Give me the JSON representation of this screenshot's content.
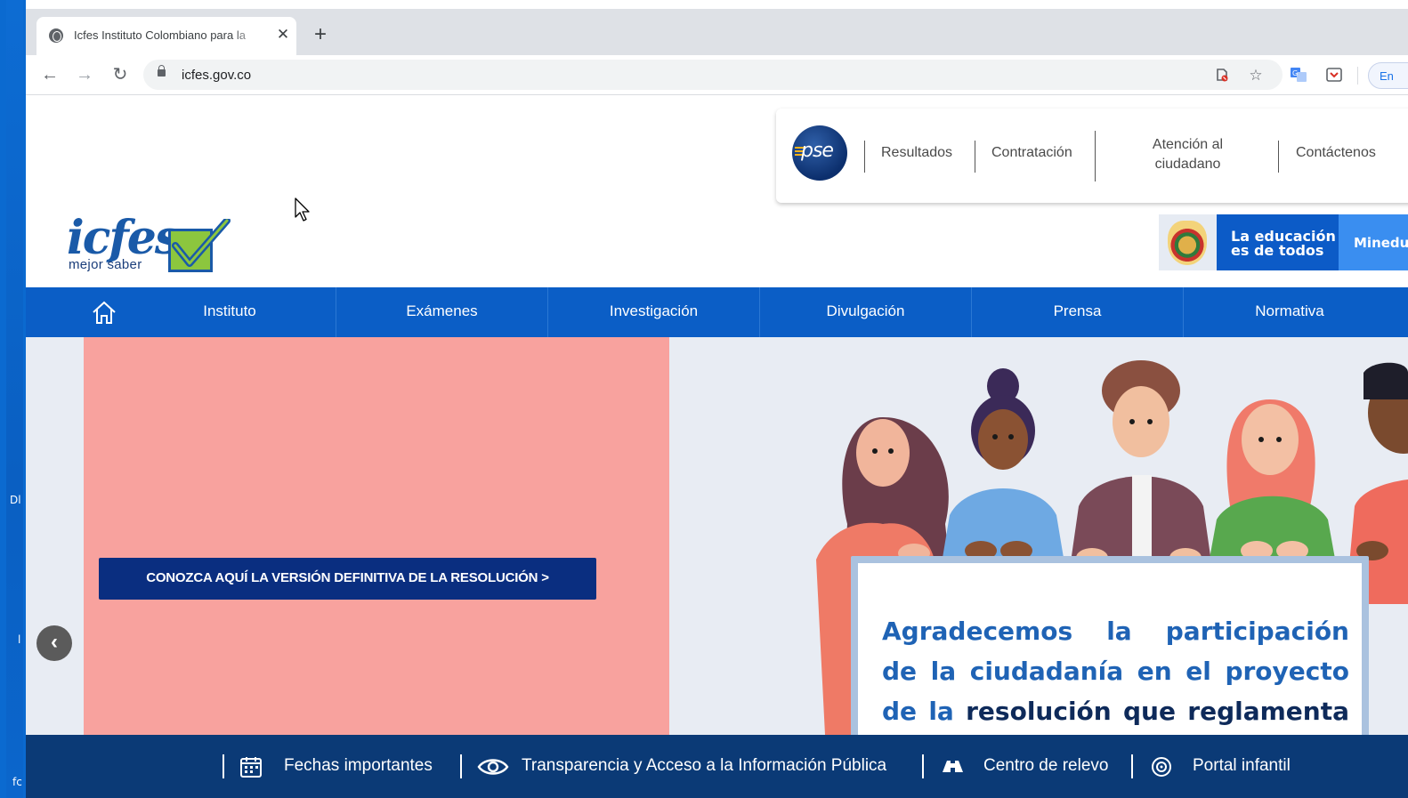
{
  "desktop": {
    "side_label_1": "Dl",
    "side_label_2": "l",
    "side_label_3": "fc"
  },
  "browser": {
    "tab": {
      "title": "Icfes Instituto Colombiano para la",
      "favicon": "globe-icon"
    },
    "new_tab": "+",
    "url": "icfes.gov.co",
    "profile_label": "En"
  },
  "header": {
    "pse_label": "pse",
    "top_menu": [
      {
        "label": "Resultados"
      },
      {
        "label": "Contratación"
      },
      {
        "label": "Atención al ciudadano"
      },
      {
        "label": "Contáctenos"
      }
    ],
    "logo": {
      "word": "icfes",
      "tagline": "mejor saber"
    },
    "gov_banner": {
      "education_line1": "La educación",
      "education_line2": "es de todos",
      "ministry": "Mineducación"
    }
  },
  "main_nav": [
    {
      "label": "Instituto"
    },
    {
      "label": "Exámenes"
    },
    {
      "label": "Investigación"
    },
    {
      "label": "Divulgación"
    },
    {
      "label": "Prensa"
    },
    {
      "label": "Normativa"
    }
  ],
  "hero": {
    "cta": "CONOZCA AQUÍ LA VERSIÓN DEFINITIVA DE LA RESOLUCIÓN >",
    "board_line1": "Agradecemos la participación",
    "board_line2": "de la ciudadanía en el proyecto",
    "board_line3_a": "de la",
    "board_line3_b": "resolución que reglamenta"
  },
  "bottom_bar": [
    {
      "label": "Fechas importantes",
      "icon": "calendar-icon"
    },
    {
      "label": "Transparencia y Acceso a la Información Pública",
      "icon": "eye-icon"
    },
    {
      "label": "Centro de relevo",
      "icon": "binoculars-icon"
    },
    {
      "label": "Portal infantil",
      "icon": "child-icon"
    }
  ],
  "colors": {
    "nav_blue": "#0b5ec6",
    "footer_navy": "#0b3a76",
    "hero_pink": "#f8a29e",
    "cta_navy": "#0a2e80",
    "board_blue": "#1f63b5"
  }
}
